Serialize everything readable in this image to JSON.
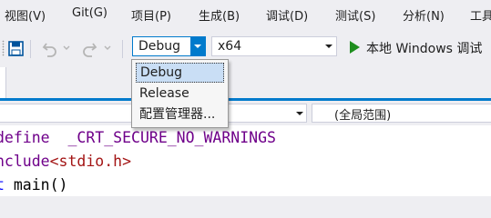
{
  "menubar": {
    "items": [
      {
        "label": "视图(V)"
      },
      {
        "label": "Git(G)"
      },
      {
        "label": "项目(P)"
      },
      {
        "label": "生成(B)"
      },
      {
        "label": "调试(D)"
      },
      {
        "label": "测试(S)"
      },
      {
        "label": "分析(N)"
      },
      {
        "label": "工具"
      }
    ]
  },
  "toolbar": {
    "save_icon": "save-all-icon",
    "undo_icon": "undo-icon",
    "redo_icon": "redo-icon",
    "configuration": "Debug",
    "platform": "x64",
    "run_label": "本地 Windows 调试"
  },
  "config_dropdown": {
    "options": [
      "Debug",
      "Release",
      "配置管理器..."
    ],
    "selected": "Debug"
  },
  "navbar": {
    "scope": "(全局范围)"
  },
  "editor": {
    "lines": [
      {
        "directive": "define",
        "rest": "  _CRT_SECURE_NO_WARNINGS"
      },
      {
        "directive": "nclude",
        "open": "<",
        "header": "stdio.h",
        "close": ">"
      },
      {
        "type": "t",
        "rest": " main()"
      }
    ]
  },
  "colors": {
    "accent": "#007acc",
    "run_green": "#1e8e1e",
    "preprocessor": "#6f008a",
    "keyword": "#0000ff",
    "string": "#a31515"
  }
}
